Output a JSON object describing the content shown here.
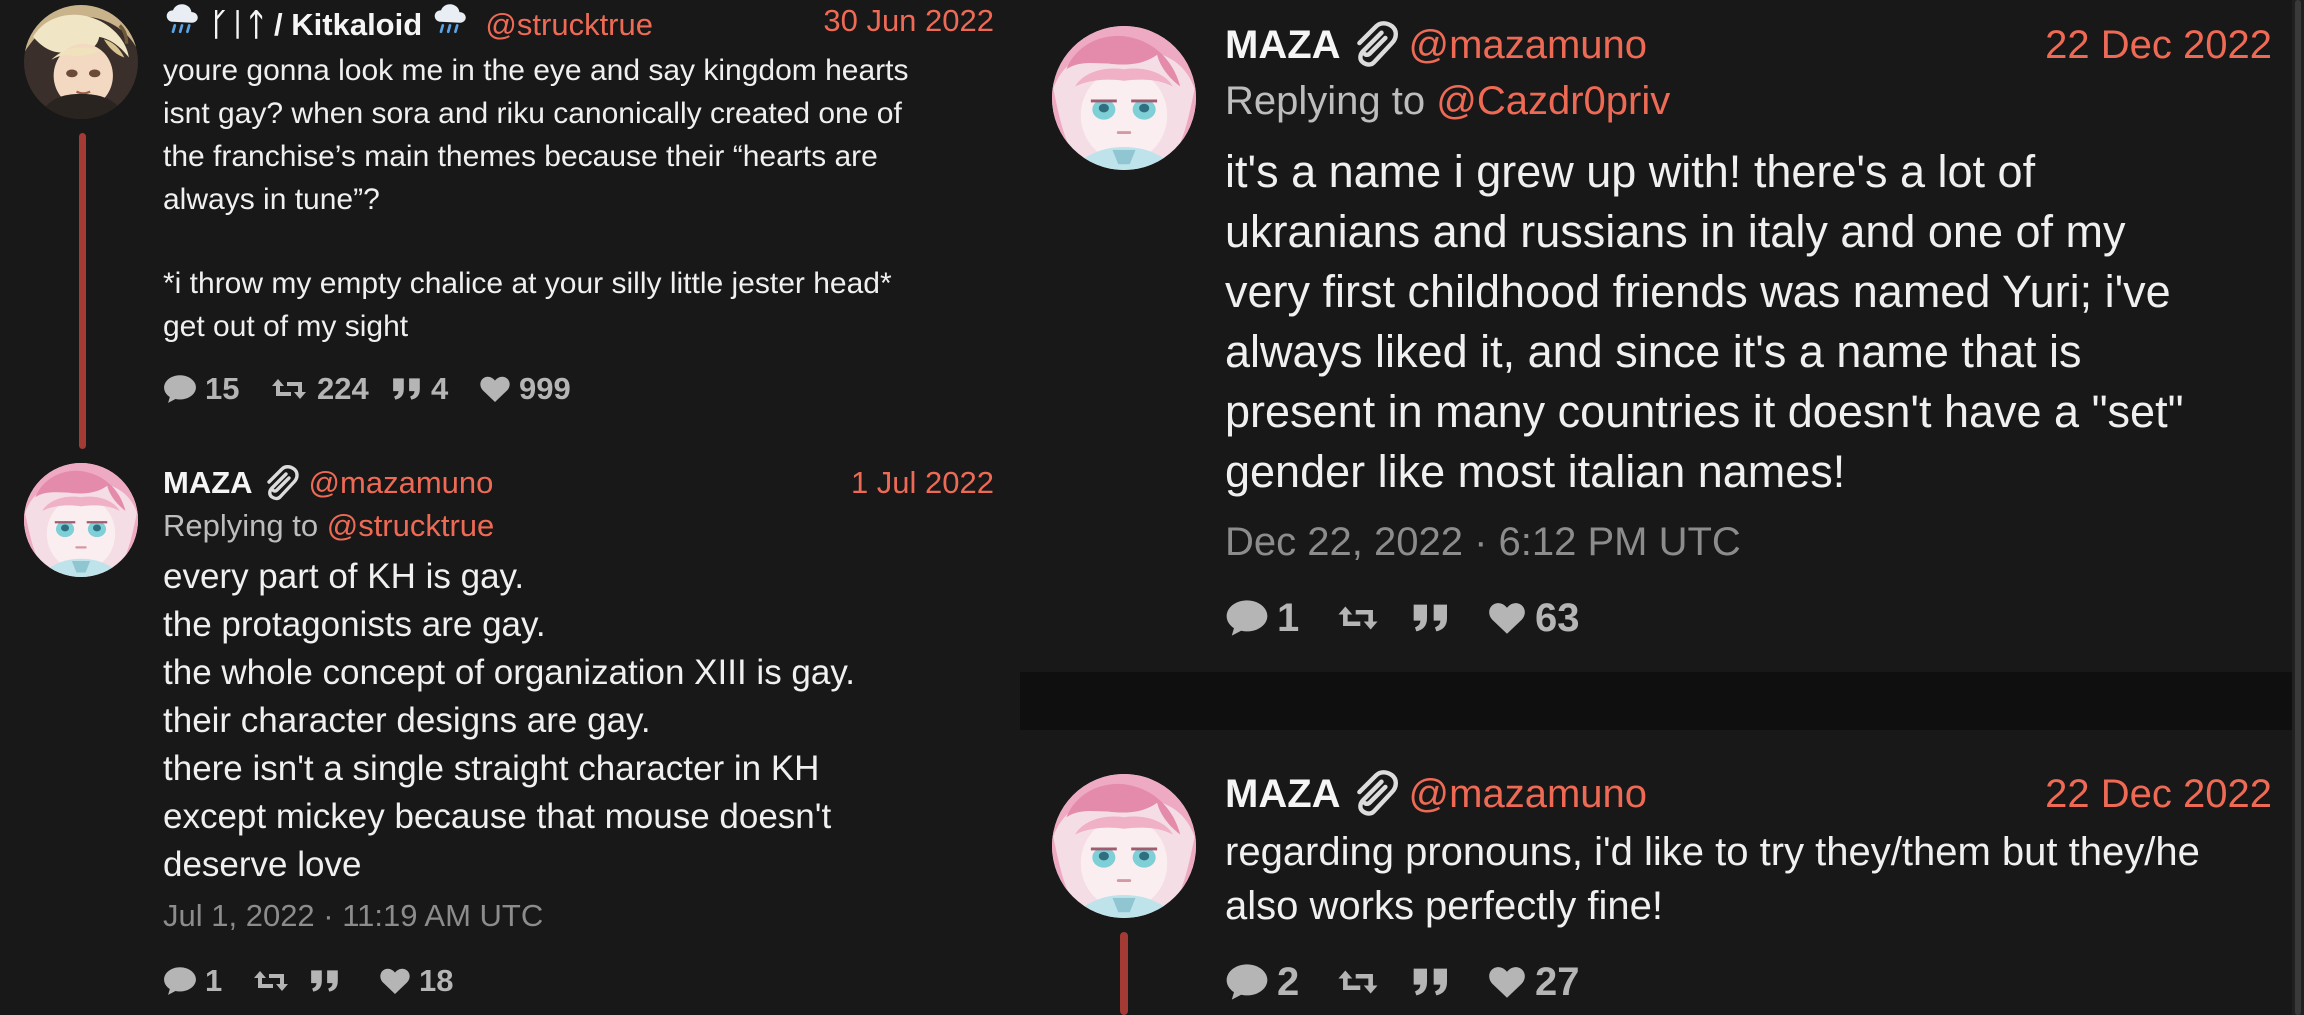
{
  "colors": {
    "accent": "#ee6a55",
    "thread_line": "#a33a33",
    "background": "#181818"
  },
  "left": {
    "tweet1": {
      "display_name_prefix": "ᚴᛁᛏ / Kitkaloid",
      "username": "@strucktrue",
      "date": "30 Jun 2022",
      "body": [
        "youre gonna look me in the eye and say kingdom hearts",
        "isnt gay? when sora and riku canonically created one of",
        "the franchise’s main themes because their “hearts are",
        "always in tune”?",
        "",
        "*i throw my empty chalice at your silly little jester head*",
        "get out of my sight"
      ],
      "stats": {
        "replies": "15",
        "retweets": "224",
        "quotes": "4",
        "likes": "999"
      },
      "icons": [
        "cloud-rain-icon",
        "comment-icon",
        "retweet-icon",
        "quote-icon",
        "heart-icon"
      ]
    },
    "tweet2": {
      "fullname": "MAZA",
      "username": "@mazamuno",
      "date": "1 Jul 2022",
      "replying_to_label": "Replying to ",
      "replying_to_user": "@strucktrue",
      "body": [
        "every part of KH is gay.",
        "the protagonists are gay.",
        "the whole concept of organization XIII is gay.",
        "their character designs are gay.",
        "there isn't a single straight character in KH",
        "except mickey because that mouse doesn't",
        "deserve love"
      ],
      "timestamp": "Jul 1, 2022 · 11:19 AM UTC",
      "stats": {
        "replies": "1",
        "retweets": "",
        "quotes": "",
        "likes": "18"
      }
    }
  },
  "right": {
    "tweet1": {
      "fullname": "MAZA",
      "username": "@mazamuno",
      "date": "22 Dec 2022",
      "replying_to_label": "Replying to ",
      "replying_to_user": "@Cazdr0priv",
      "body": [
        "it's a name i grew up with! there's a lot of",
        "ukranians and russians in italy and one of my",
        "very first childhood friends was named Yuri; i've",
        "always liked it, and since it's a name that is",
        "present in many countries it doesn't have a \"set\"",
        "gender like most italian names!"
      ],
      "timestamp": "Dec 22, 2022 · 6:12 PM UTC",
      "stats": {
        "replies": "1",
        "retweets": "",
        "quotes": "",
        "likes": "63"
      }
    },
    "tweet2": {
      "fullname": "MAZA",
      "username": "@mazamuno",
      "date": "22 Dec 2022",
      "body": [
        "regarding pronouns, i'd like to try they/them but they/he",
        "also works perfectly fine!"
      ],
      "stats": {
        "replies": "2",
        "retweets": "",
        "quotes": "",
        "likes": "27"
      }
    }
  }
}
